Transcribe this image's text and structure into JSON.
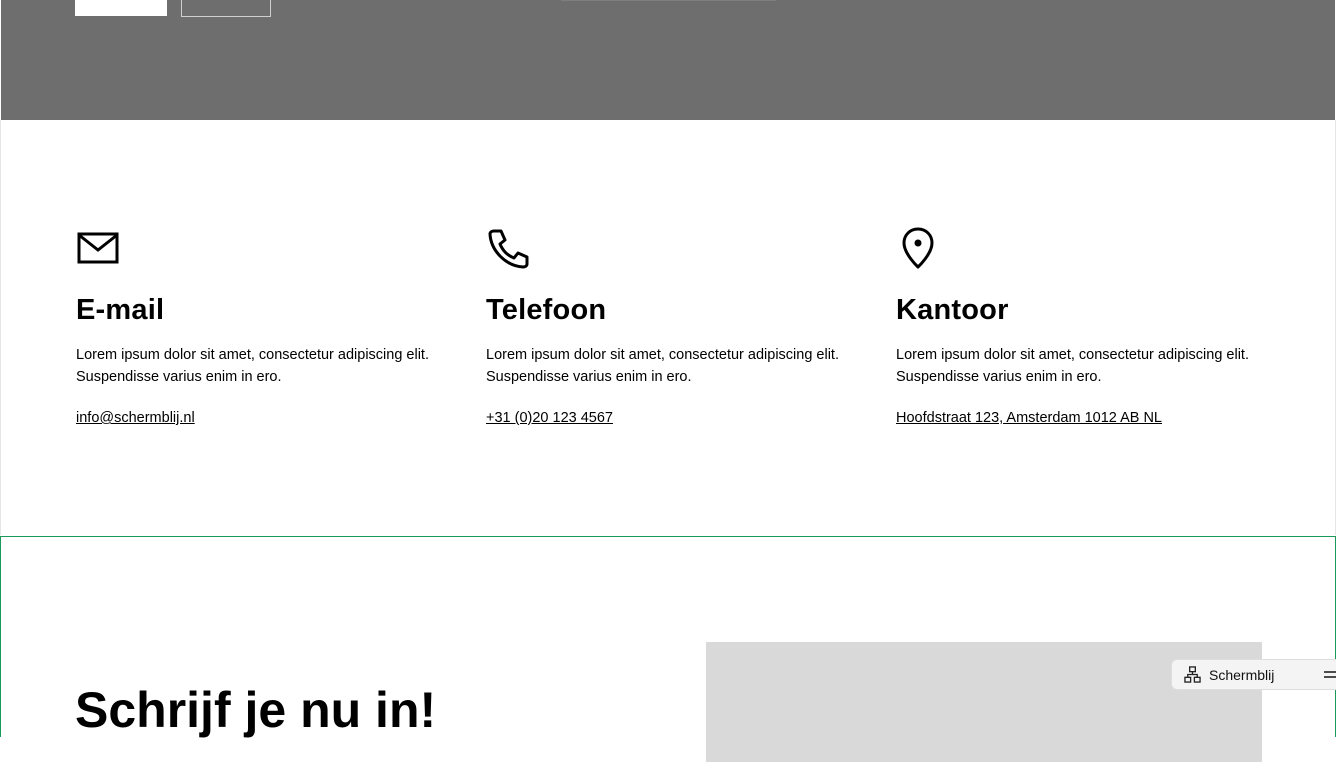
{
  "hero": {
    "primary_button": "",
    "secondary_button": ""
  },
  "contact": {
    "items": [
      {
        "icon": "mail-icon",
        "title": "E-mail",
        "text": "Lorem ipsum dolor sit amet, consectetur adipiscing elit. Suspendisse varius enim in ero.",
        "link": "info@schermblij.nl"
      },
      {
        "icon": "phone-icon",
        "title": "Telefoon",
        "text": "Lorem ipsum dolor sit amet, consectetur adipiscing elit. Suspendisse varius enim in ero.",
        "link": "+31 (0)20 123 4567"
      },
      {
        "icon": "map-pin-icon",
        "title": "Kantoor",
        "text": "Lorem ipsum dolor sit amet, consectetur adipiscing elit. Suspendisse varius enim in ero.",
        "link": "Hoofdstraat 123, Amsterdam 1012 AB NL"
      }
    ]
  },
  "signup": {
    "heading": "Schrijf je nu in!"
  },
  "navigator_widget": {
    "icon": "sitemap-icon",
    "label": "Schermblij",
    "menu_icon": "menu-icon"
  },
  "colors": {
    "hero_background": "#6e6e6e",
    "section_outline": "#1a9a5a",
    "image_placeholder": "#d9d9d9"
  }
}
